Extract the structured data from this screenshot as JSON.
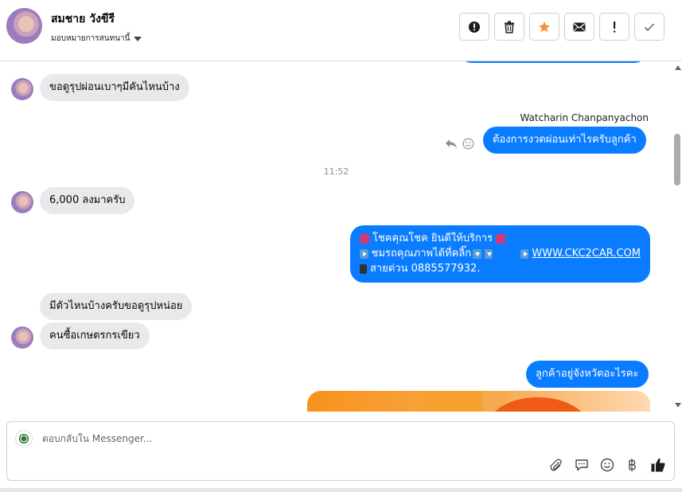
{
  "header": {
    "contact_name": "สมชาย วังขีรี",
    "assign_label": "มอบหมายการสนทนานี้",
    "actions": [
      {
        "name": "report-spam-button",
        "icon": "alert-circle-icon"
      },
      {
        "name": "delete-button",
        "icon": "trash-icon"
      },
      {
        "name": "star-button",
        "icon": "star-icon"
      },
      {
        "name": "mark-unread-button",
        "icon": "envelope-icon"
      },
      {
        "name": "follow-up-button",
        "icon": "exclamation-icon"
      },
      {
        "name": "mark-done-button",
        "icon": "check-icon"
      }
    ],
    "star_color": "#f7923a"
  },
  "messages": {
    "m1": "ขอดูรุปผ่อนเบาๆมีคันไหนบ้าง",
    "sender_name": "Watcharin Chanpanyachon",
    "m2": "ต้องการงวดผ่อนเท่าไรครับลูกค้า",
    "time_1": "11:52",
    "m3": "6,000 ลงมาครับ",
    "promo_line1": "โชคคุณโชค ยินดีให้บริการ",
    "promo_line2": "ชมรถคุณภาพได้ที่คลิ๊ก",
    "promo_link": "WWW.CKC2CAR.COM",
    "promo_line3": "สายด่วน 0885577932.",
    "m4": "มีตัวไหนบ้างครับขอดูรุปหน่อย",
    "m5": "คนซื้อเกษตรกรเขียว",
    "m6": "ลูกค้าอยู่จังหวัดอะไรคะ"
  },
  "composer": {
    "placeholder": "ตอบกลับใน Messenger...",
    "tools": [
      "paperclip-icon",
      "chat-bubble-icon",
      "smiley-icon",
      "baht-icon",
      "thumbs-up-icon"
    ]
  },
  "colors": {
    "outgoing": "#0a7cff",
    "incoming": "#e9e9eb"
  }
}
